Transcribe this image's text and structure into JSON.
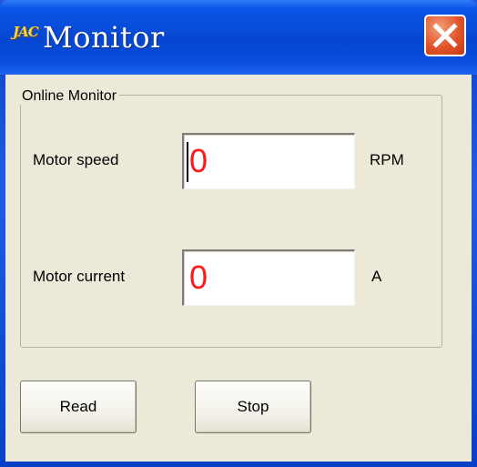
{
  "window": {
    "title": "Monitor",
    "app_icon_text": "JAC",
    "close_icon": "close-icon"
  },
  "group": {
    "label": "Online Monitor"
  },
  "motor_speed": {
    "label": "Motor speed",
    "value": "0",
    "unit": "RPM"
  },
  "motor_current": {
    "label": "Motor current",
    "value": "0",
    "unit": "A"
  },
  "buttons": {
    "read": "Read",
    "stop": "Stop"
  },
  "colors": {
    "titlebar": "#0646d0",
    "client_bg": "#ece9d8",
    "value_text": "#ff1a1a",
    "close_button": "#e2542a"
  }
}
